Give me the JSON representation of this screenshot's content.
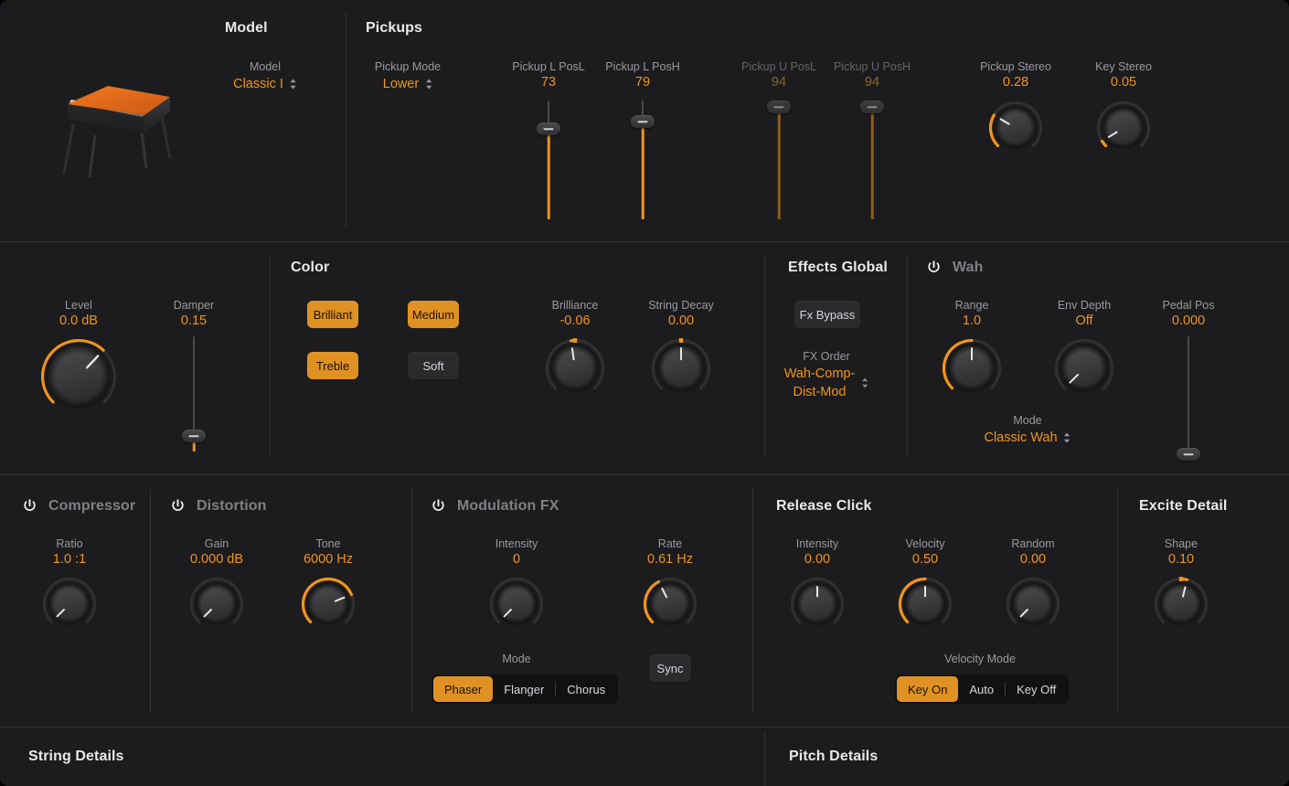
{
  "theme": {
    "accent": "#f0941e",
    "accent_button": "#e09123",
    "bg": "#1c1c1e",
    "label": "#9a9a9e",
    "divider": "#343437"
  },
  "sections": {
    "model": {
      "title": "Model"
    },
    "pickups": {
      "title": "Pickups"
    },
    "color": {
      "title": "Color"
    },
    "effects_global": {
      "title": "Effects Global"
    },
    "wah": {
      "title": "Wah",
      "power_icon": "power-icon",
      "enabled": false
    },
    "compressor": {
      "title": "Compressor",
      "power_icon": "power-icon",
      "enabled": false
    },
    "distortion": {
      "title": "Distortion",
      "power_icon": "power-icon",
      "enabled": false
    },
    "modulation_fx": {
      "title": "Modulation FX",
      "power_icon": "power-icon",
      "enabled": false
    },
    "release_click": {
      "title": "Release Click"
    },
    "excite_detail": {
      "title": "Excite Detail"
    },
    "string_details": {
      "title": "String Details"
    },
    "pitch_details": {
      "title": "Pitch Details"
    }
  },
  "model": {
    "label": "Model",
    "value": "Classic I",
    "chevron_icon": "chevron-updown-icon",
    "image": "electric-piano-image"
  },
  "pickups": {
    "mode": {
      "label": "Pickup Mode",
      "value": "Lower",
      "chevron_icon": "chevron-updown-icon"
    },
    "sliders": [
      {
        "label": "Pickup L PosL",
        "value": "73",
        "pct": 73,
        "enabled": true
      },
      {
        "label": "Pickup L PosH",
        "value": "79",
        "pct": 79,
        "enabled": true
      },
      {
        "label": "Pickup U PosL",
        "value": "94",
        "pct": 94,
        "enabled": false
      },
      {
        "label": "Pickup U PosH",
        "value": "94",
        "pct": 94,
        "enabled": false
      }
    ],
    "knobs": [
      {
        "label": "Pickup Stereo",
        "value": "0.28",
        "pct": 28,
        "bipolar": false
      },
      {
        "label": "Key Stereo",
        "value": "0.05",
        "pct": 5,
        "bipolar": false
      }
    ]
  },
  "main": {
    "level": {
      "label": "Level",
      "value": "0.0 dB",
      "pct": 66,
      "bipolar": false
    },
    "damper": {
      "label": "Damper",
      "value": "0.15",
      "pct": 7
    },
    "color_buttons": [
      {
        "label": "Brilliant",
        "on": true
      },
      {
        "label": "Medium",
        "on": true
      },
      {
        "label": "Treble",
        "on": true
      },
      {
        "label": "Soft",
        "on": false
      }
    ],
    "brilliance": {
      "label": "Brilliance",
      "value": "-0.06",
      "pct": 47,
      "bipolar": true
    },
    "string_decay": {
      "label": "String Decay",
      "value": "0.00",
      "pct": 50,
      "bipolar": true
    }
  },
  "effects_global": {
    "fx_bypass": {
      "label": "Fx Bypass",
      "on": false
    },
    "fx_order": {
      "label": "FX Order",
      "value": "Wah-Comp-\nDist-Mod",
      "line1": "Wah-Comp-",
      "line2": "Dist-Mod",
      "chevron_icon": "chevron-updown-icon"
    }
  },
  "wah": {
    "range": {
      "label": "Range",
      "value": "1.0",
      "pct": 50,
      "bipolar": false
    },
    "env_depth": {
      "label": "Env Depth",
      "value": "Off",
      "pct": 0,
      "bipolar": false
    },
    "mode": {
      "label": "Mode",
      "value": "Classic Wah",
      "chevron_icon": "chevron-updown-icon"
    },
    "pedal_pos": {
      "label": "Pedal Pos",
      "value": "0.000",
      "pct": 0
    }
  },
  "compressor": {
    "ratio": {
      "label": "Ratio",
      "value": "1.0 :1",
      "pct": 0,
      "bipolar": false
    }
  },
  "distortion": {
    "gain": {
      "label": "Gain",
      "value": "0.000 dB",
      "pct": 0,
      "bipolar": false
    },
    "tone": {
      "label": "Tone",
      "value": "6000 Hz",
      "pct": 75,
      "bipolar": false
    }
  },
  "modulation_fx": {
    "intensity": {
      "label": "Intensity",
      "value": "0",
      "pct": 0,
      "bipolar": false
    },
    "rate": {
      "label": "Rate",
      "value": "0.61 Hz",
      "pct": 40,
      "bipolar": false
    },
    "mode": {
      "label": "Mode",
      "options": [
        {
          "label": "Phaser",
          "on": true
        },
        {
          "label": "Flanger",
          "on": false
        },
        {
          "label": "Chorus",
          "on": false
        }
      ]
    },
    "sync": {
      "label": "Sync",
      "on": false
    }
  },
  "release_click": {
    "intensity": {
      "label": "Intensity",
      "value": "0.00",
      "pct": 50,
      "bipolar": true
    },
    "velocity": {
      "label": "Velocity",
      "value": "0.50",
      "pct": 50,
      "bipolar": false
    },
    "random": {
      "label": "Random",
      "value": "0.00",
      "pct": 0,
      "bipolar": false
    },
    "velocity_mode": {
      "label": "Velocity Mode",
      "options": [
        {
          "label": "Key On",
          "on": true
        },
        {
          "label": "Auto",
          "on": false
        },
        {
          "label": "Key Off",
          "on": false
        }
      ]
    }
  },
  "excite_detail": {
    "shape": {
      "label": "Shape",
      "value": "0.10",
      "pct": 55,
      "bipolar": true
    }
  }
}
